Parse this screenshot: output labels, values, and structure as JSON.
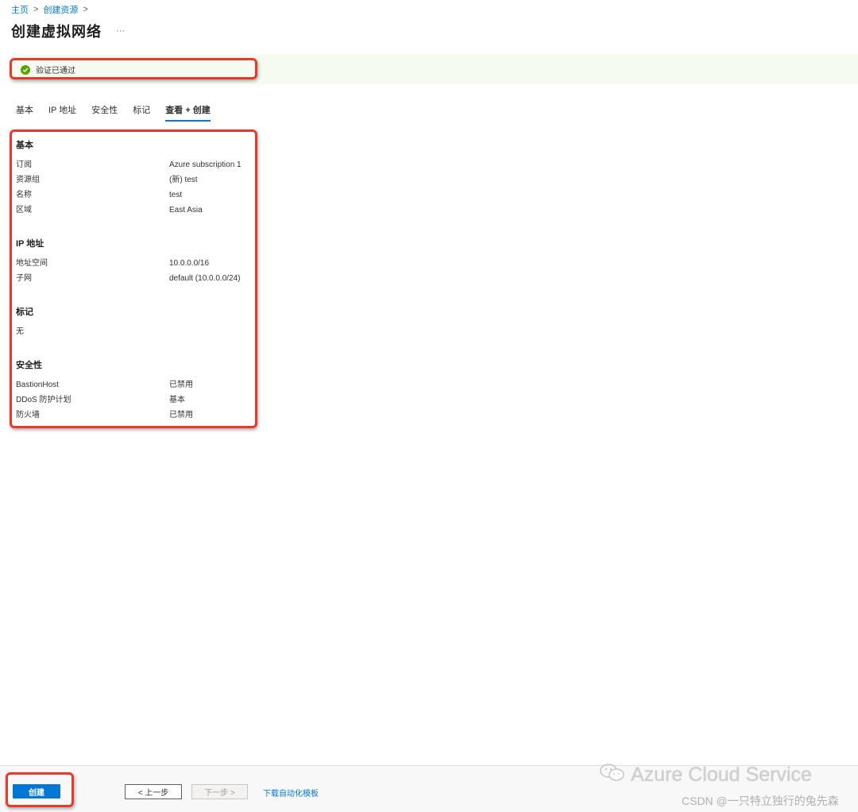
{
  "breadcrumb": {
    "home": "主页",
    "create_resource": "创建资源",
    "separator": ">"
  },
  "page": {
    "title": "创建虚拟网络",
    "more": "···"
  },
  "validation": {
    "text": "验证已通过",
    "color": "#57a300"
  },
  "tabs": [
    {
      "label": "基本",
      "active": false
    },
    {
      "label": "IP 地址",
      "active": false
    },
    {
      "label": "安全性",
      "active": false
    },
    {
      "label": "标记",
      "active": false
    },
    {
      "label": "查看 + 创建",
      "active": true
    }
  ],
  "summary": {
    "basics": {
      "title": "基本",
      "rows": [
        {
          "key": "订阅",
          "value": "Azure subscription 1"
        },
        {
          "key": "资源组",
          "value": "(新) test"
        },
        {
          "key": "名称",
          "value": "test"
        },
        {
          "key": "区域",
          "value": "East Asia"
        }
      ]
    },
    "ip": {
      "title": "IP 地址",
      "rows": [
        {
          "key": "地址空间",
          "value": "10.0.0.0/16"
        },
        {
          "key": "子网",
          "value": "default (10.0.0.0/24)"
        }
      ]
    },
    "tags": {
      "title": "标记",
      "none": "无"
    },
    "security": {
      "title": "安全性",
      "rows": [
        {
          "key": "BastionHost",
          "value": "已禁用"
        },
        {
          "key": "DDoS 防护计划",
          "value": "基本"
        },
        {
          "key": "防火墙",
          "value": "已禁用"
        }
      ]
    }
  },
  "footer": {
    "create": "创建",
    "previous": "< 上一步",
    "next": "下一步 >",
    "download_template": "下载自动化模板"
  },
  "watermark": {
    "brand": "Azure Cloud Service",
    "csdn": "CSDN @一只特立独行的兔先森"
  },
  "colors": {
    "accent": "#0078d4",
    "annotation": "#e43b2e",
    "success_bg": "#f6fbf2"
  }
}
